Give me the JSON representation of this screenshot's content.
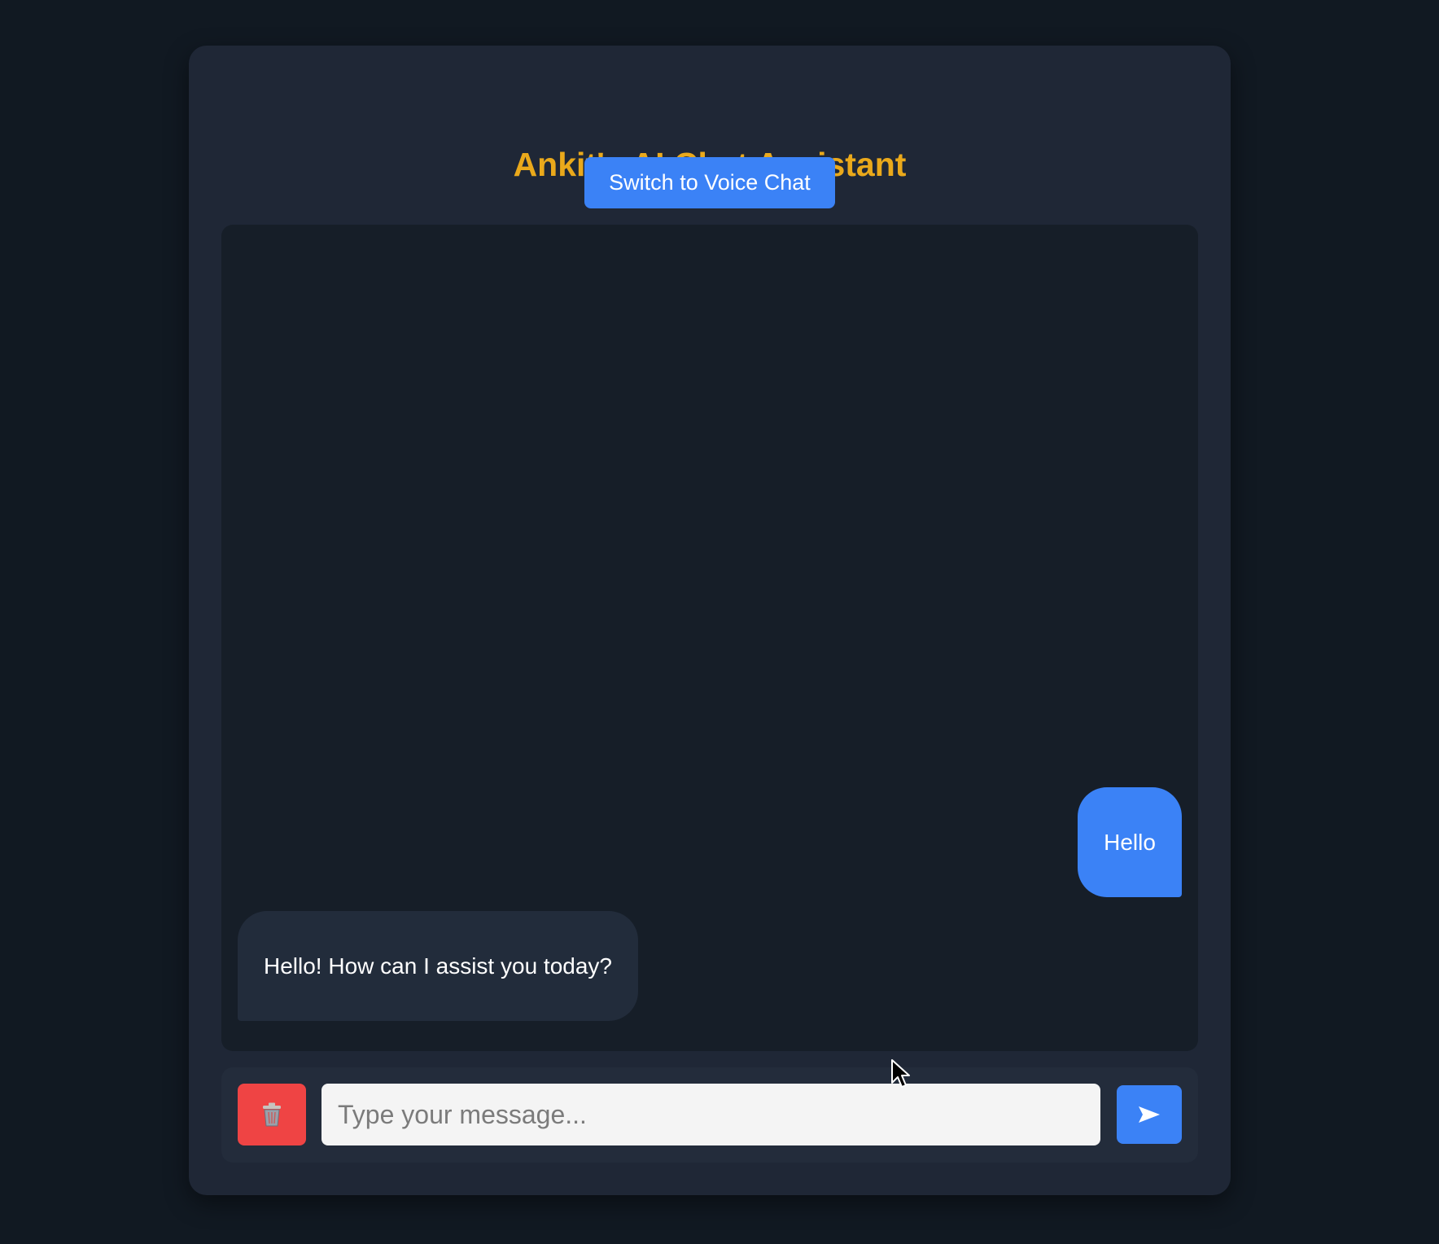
{
  "app": {
    "title": "Ankit's AI Chat Assistant"
  },
  "header": {
    "voice_button_label": "Switch to Voice Chat"
  },
  "messages": [
    {
      "role": "user",
      "text": "Hello"
    },
    {
      "role": "assistant",
      "text": "Hello! How can I assist you today?"
    }
  ],
  "composer": {
    "placeholder": "Type your message...",
    "value": "",
    "clear_icon": "trash-icon",
    "send_icon": "send-arrow-icon"
  },
  "colors": {
    "page_background": "#111922",
    "card_background": "#1f2736",
    "title": "#eaa91b",
    "accent_blue": "#3b82f6",
    "danger_red": "#ef4444",
    "assistant_bubble": "#222c3b"
  }
}
